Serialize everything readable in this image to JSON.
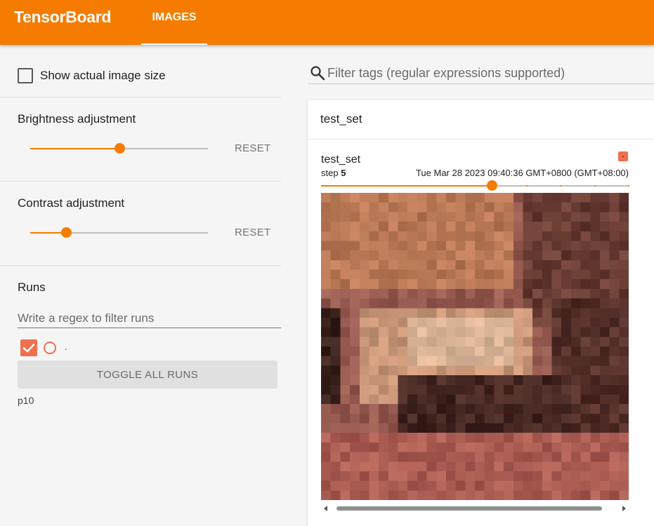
{
  "app": {
    "title": "TensorBoard"
  },
  "tabs": [
    {
      "label": "IMAGES",
      "active": true
    }
  ],
  "colors": {
    "brand": "#f57c00",
    "run": "#ef6f4e"
  },
  "sidebar": {
    "show_actual_size": {
      "label": "Show actual image size",
      "checked": false
    },
    "brightness": {
      "title": "Brightness adjustment",
      "reset_label": "RESET",
      "level": 0.5
    },
    "contrast": {
      "title": "Contrast adjustment",
      "reset_label": "RESET",
      "level": 0.2
    },
    "runs": {
      "title": "Runs",
      "filter_placeholder": "Write a regex to filter runs",
      "items": [
        {
          "name": ".",
          "checked": true
        }
      ],
      "toggle_label": "TOGGLE ALL RUNS",
      "group": "p10"
    }
  },
  "main": {
    "search": {
      "placeholder": "Filter tags (regular expressions supported)",
      "icon": "search-icon"
    },
    "group": {
      "title": "test_set",
      "card": {
        "title": "test_set",
        "step_label": "step",
        "step_value": "5",
        "timestamp": "Tue Mar 28 2023 09:40:36 GMT+0800 (GMT+08:00)",
        "step_position": 0.55
      }
    }
  }
}
